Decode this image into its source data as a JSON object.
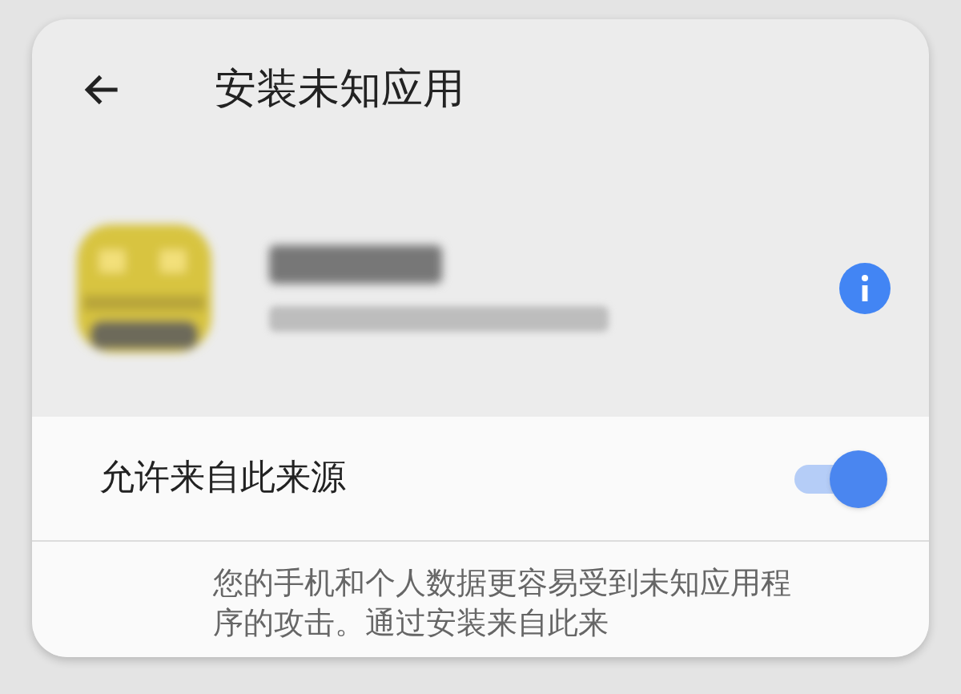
{
  "header": {
    "title": "安装未知应用"
  },
  "setting": {
    "label": "允许来自此来源",
    "on": true
  },
  "description": {
    "lines": [
      "您的手机和个人数据更容易受到未知应用程",
      "序的攻击。通过安装来自此来"
    ]
  }
}
